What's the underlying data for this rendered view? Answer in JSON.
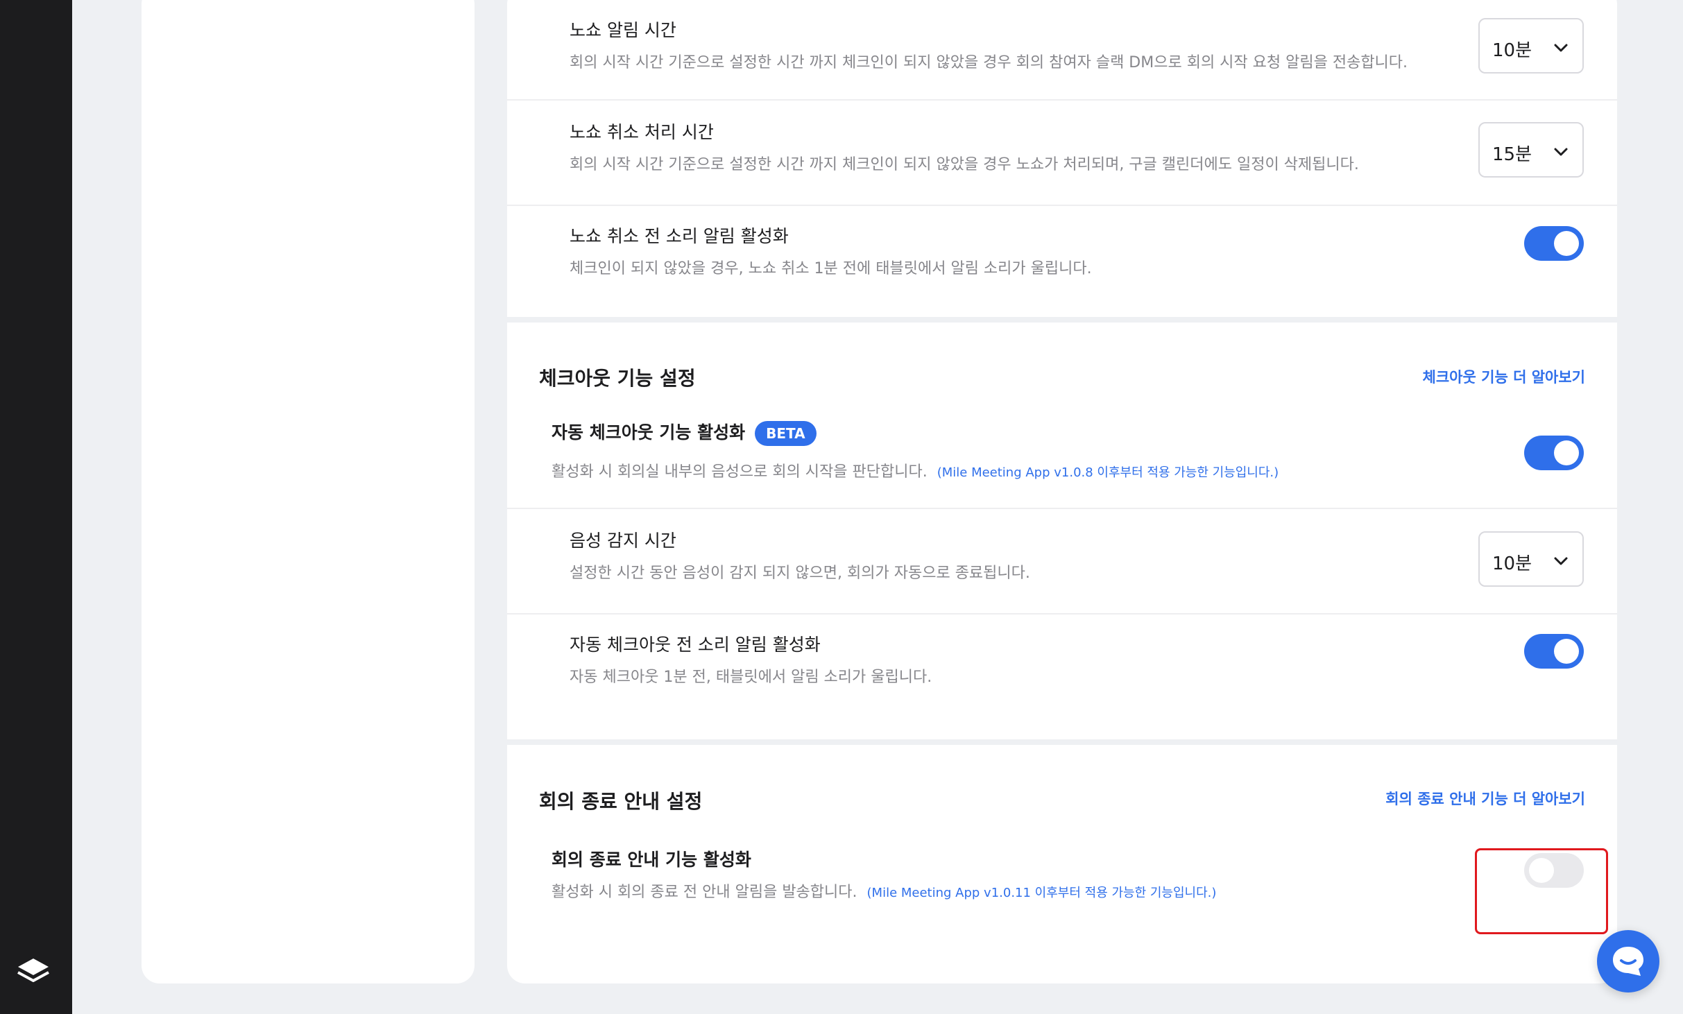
{
  "rail": {
    "logo_icon": "layers-logo-icon"
  },
  "noshow": {
    "alert_time": {
      "title": "노쇼 알림 시간",
      "desc": "회의 시작 시간 기준으로 설정한 시간 까지 체크인이 되지 않았을 경우 회의 참여자 슬랙 DM으로 회의 시작 요청 알림을 전송합니다.",
      "value": "10분"
    },
    "cancel_time": {
      "title": "노쇼 취소 처리 시간",
      "desc": "회의 시작 시간 기준으로 설정한 시간 까지 체크인이 되지 않았을 경우 노쇼가 처리되며, 구글 캘린더에도 일정이 삭제됩니다.",
      "value": "15분"
    },
    "sound_alert": {
      "title": "노쇼 취소 전 소리 알림 활성화",
      "desc": "체크인이 되지 않았을 경우, 노쇼 취소 1분 전에 태블릿에서 알림 소리가 울립니다.",
      "enabled": true
    }
  },
  "checkout": {
    "section_title": "체크아웃 기능 설정",
    "learn_more": "체크아웃 기능 더 알아보기",
    "auto_checkout": {
      "title": "자동 체크아웃 기능 활성화",
      "badge": "BETA",
      "desc": "활성화 시 회의실 내부의 음성으로 회의 시작을 판단합니다.",
      "note": "(Mile Meeting App v1.0.8 이후부터 적용 가능한 기능입니다.)",
      "enabled": true
    },
    "voice_detect_time": {
      "title": "음성 감지 시간",
      "desc": "설정한 시간 동안 음성이 감지 되지 않으면, 회의가 자동으로 종료됩니다.",
      "value": "10분"
    },
    "sound_alert": {
      "title": "자동 체크아웃 전 소리 알림 활성화",
      "desc": "자동 체크아웃 1분 전, 태블릿에서 알림 소리가 울립니다.",
      "enabled": true
    }
  },
  "meeting_end": {
    "section_title": "회의 종료 안내 설정",
    "learn_more": "회의 종료 안내 기능 더 알아보기",
    "notice": {
      "title": "회의 종료 안내 기능 활성화",
      "desc": "활성화 시 회의 종료 전 안내 알림을 발송합니다.",
      "note": "(Mile Meeting App v1.0.11 이후부터 적용 가능한 기능입니다.)",
      "enabled": false
    }
  },
  "colors": {
    "accent": "#2f6fea",
    "highlight": "#e0191e",
    "rail": "#1c1c1e"
  },
  "chat": {
    "icon": "chat-bubble-icon"
  }
}
